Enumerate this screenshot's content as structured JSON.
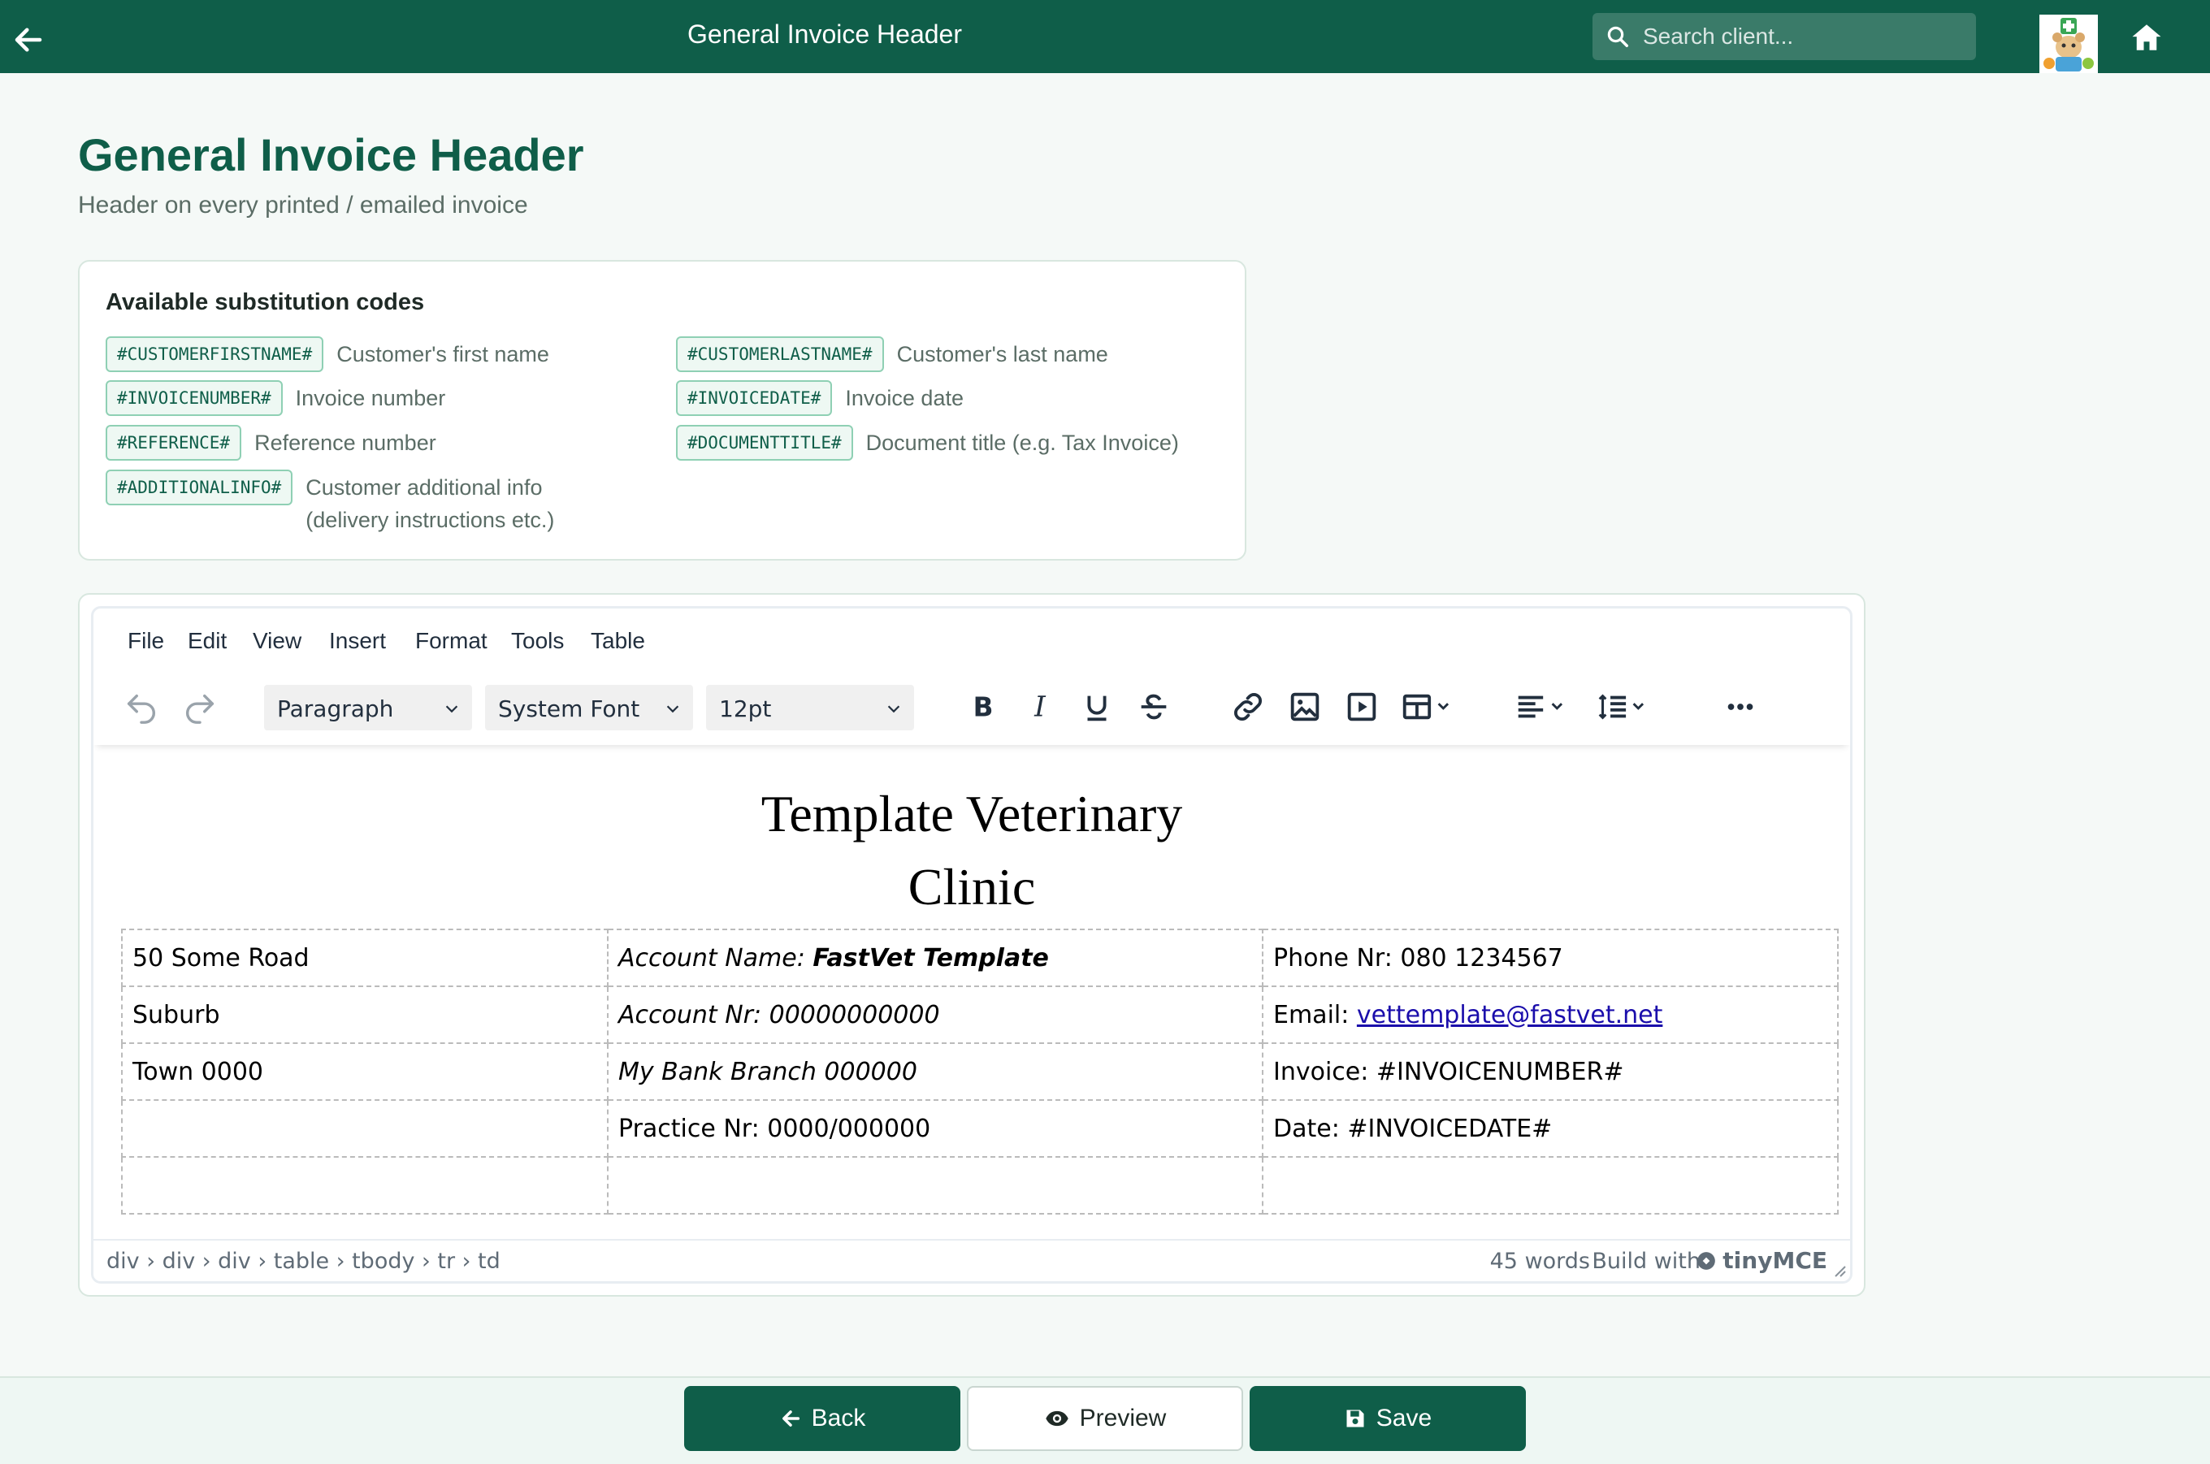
{
  "topbar": {
    "title": "General Invoice Header",
    "search_placeholder": "Search client...",
    "back_icon": "arrow-left",
    "home_icon": "home",
    "avatar_icon": "clinic-logo"
  },
  "header": {
    "title": "General Invoice Header",
    "subtitle": "Header on every printed / emailed invoice"
  },
  "codes": {
    "heading": "Available substitution codes",
    "items": [
      {
        "code": "#CUSTOMERFIRSTNAME#",
        "desc": "Customer's first name"
      },
      {
        "code": "#CUSTOMERLASTNAME#",
        "desc": "Customer's last name"
      },
      {
        "code": "#INVOICENUMBER#",
        "desc": "Invoice number"
      },
      {
        "code": "#INVOICEDATE#",
        "desc": "Invoice date"
      },
      {
        "code": "#REFERENCE#",
        "desc": "Reference number"
      },
      {
        "code": "#DOCUMENTTITLE#",
        "desc": "Document title (e.g. Tax Invoice)"
      },
      {
        "code": "#ADDITIONALINFO#",
        "desc": "Customer additional info (delivery instructions etc.)"
      }
    ]
  },
  "editor": {
    "menu": [
      "File",
      "Edit",
      "View",
      "Insert",
      "Format",
      "Tools",
      "Table"
    ],
    "toolbar": {
      "block_format": "Paragraph",
      "font_family": "System Font",
      "font_size": "12pt"
    },
    "content": {
      "clinic_name": "Template Veterinary Clinic",
      "table": {
        "address_1": "50 Some Road",
        "address_2": "Suburb",
        "address_3": "Town 0000",
        "account_name_label": "Account Name: ",
        "account_name_value": "FastVet Template",
        "account_nr": "Account Nr: 00000000000",
        "bank_branch": "My Bank Branch 000000",
        "practice_nr": "Practice Nr: 0000/000000",
        "phone": "Phone Nr: 080 1234567",
        "email_label": "Email: ",
        "email_value": "vettemplate@fastvet.net",
        "invoice": "Invoice: #INVOICENUMBER#",
        "date": "Date: #INVOICEDATE#"
      }
    },
    "statusbar": {
      "path": "div › div › div › table › tbody › tr › td",
      "word_count": "45 words",
      "build_with": "Build with",
      "brand": "tinyMCE"
    }
  },
  "footer": {
    "back_label": "Back",
    "preview_label": "Preview",
    "save_label": "Save"
  },
  "colors": {
    "brand": "#0f5e49",
    "background": "#f5f9f7",
    "chip_border": "#8fd0b4"
  }
}
